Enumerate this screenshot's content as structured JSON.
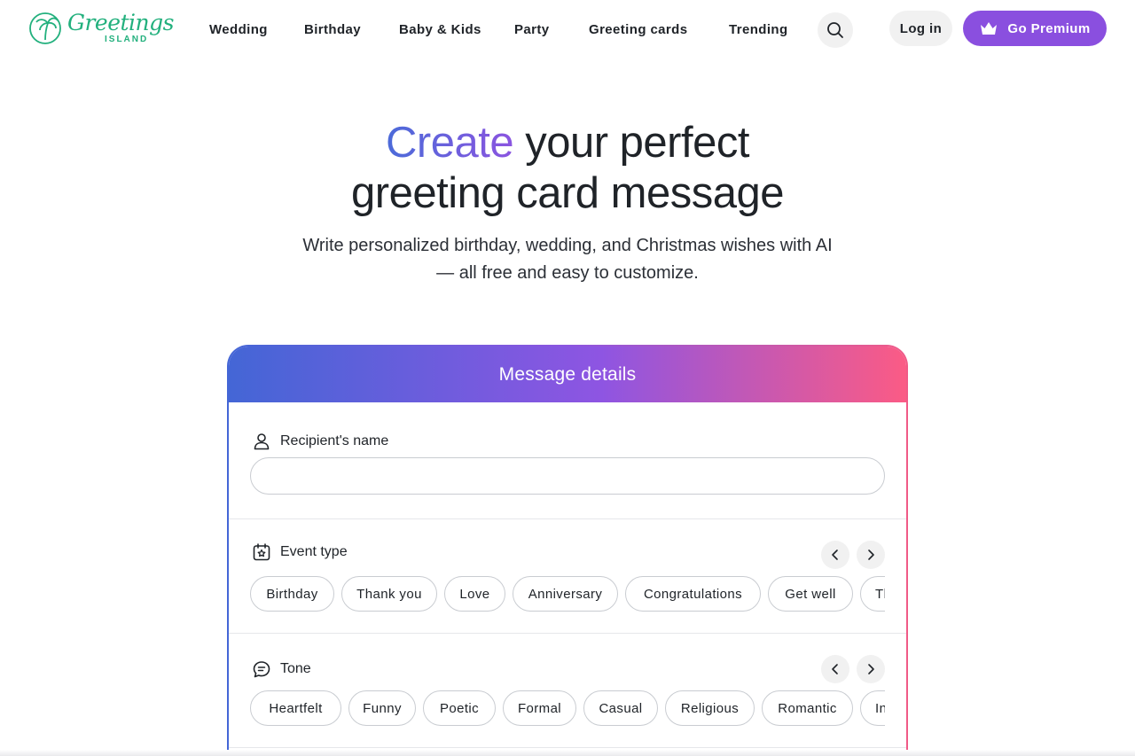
{
  "logo": {
    "script": "Greetings",
    "sub": "ISLAND"
  },
  "nav": {
    "items": [
      "Wedding",
      "Birthday",
      "Baby & Kids",
      "Party",
      "Greeting cards",
      "Trending"
    ]
  },
  "header": {
    "login_label": "Log in",
    "premium_label": "Go Premium"
  },
  "hero": {
    "title_highlight": "Create",
    "title_rest_line1": " your perfect",
    "title_line2": "greeting card message",
    "subtitle": "Write personalized birthday, wedding, and Christmas wishes with AI — all free and easy to customize."
  },
  "card": {
    "title": "Message details",
    "recipient": {
      "label": "Recipient's name",
      "value": "",
      "placeholder": ""
    },
    "event_type": {
      "label": "Event type",
      "options": [
        "Birthday",
        "Thank you",
        "Love",
        "Anniversary",
        "Congratulations",
        "Get well",
        "Thinking of you"
      ]
    },
    "tone": {
      "label": "Tone",
      "options": [
        "Heartfelt",
        "Funny",
        "Poetic",
        "Formal",
        "Casual",
        "Religious",
        "Romantic",
        "Inspirational"
      ]
    }
  },
  "colors": {
    "brand_green": "#22b07d",
    "premium_purple": "#8a4fdf",
    "gradient_start": "#4466d6",
    "gradient_mid": "#8e55e2",
    "gradient_end": "#fb5b85"
  },
  "icons": [
    "palm-tree-logo-icon",
    "search-icon",
    "crown-icon",
    "user-icon",
    "calendar-star-icon",
    "chat-bubble-icon",
    "chevron-left-icon",
    "chevron-right-icon"
  ]
}
